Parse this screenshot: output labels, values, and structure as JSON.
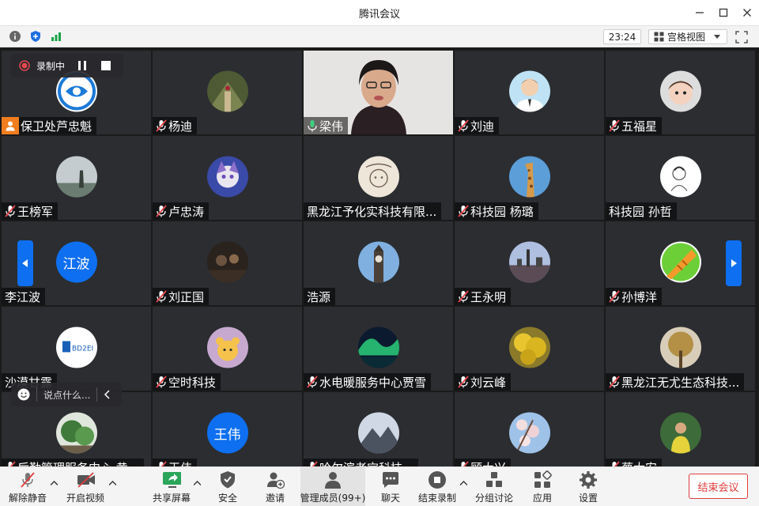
{
  "window": {
    "title": "腾讯会议"
  },
  "toolbar": {
    "timer": "23:24",
    "view_label": "宫格视图"
  },
  "recording": {
    "label": "录制中"
  },
  "chat": {
    "placeholder": "说点什么..."
  },
  "participants": [
    {
      "name": "保卫处芦忠魁",
      "avatar": "logo-badge-blue",
      "muted": false,
      "host": true
    },
    {
      "name": "杨迪",
      "avatar": "forest-photo",
      "muted": true
    },
    {
      "name": "梁伟",
      "avatar": "video-feed",
      "muted": false,
      "speaking": true
    },
    {
      "name": "刘迪",
      "avatar": "cartoon-man",
      "muted": true
    },
    {
      "name": "五福星",
      "avatar": "child-photo",
      "muted": true
    },
    {
      "name": "王榜军",
      "avatar": "misty-photo",
      "muted": true
    },
    {
      "name": "卢忠涛",
      "avatar": "anime-character",
      "muted": true
    },
    {
      "name": "黑龙江予化实科技有限...",
      "avatar": "sketch-badge",
      "muted": false
    },
    {
      "name": "科技园 杨璐",
      "avatar": "giraffe-photo",
      "muted": true
    },
    {
      "name": "科技园 孙哲",
      "avatar": "line-drawing",
      "muted": false
    },
    {
      "name": "李江波",
      "avatar_text": "江波",
      "muted": false
    },
    {
      "name": "刘正国",
      "avatar": "dark-photo",
      "muted": true
    },
    {
      "name": "浩源",
      "avatar": "clocktower-photo",
      "muted": false
    },
    {
      "name": "王永明",
      "avatar": "city-photo",
      "muted": true
    },
    {
      "name": "孙博洋",
      "avatar": "fruit-icon",
      "muted": true
    },
    {
      "name": "沙漠甘露",
      "avatar": "bd-logo",
      "muted": false
    },
    {
      "name": "空时科技",
      "avatar": "cartoon-bear",
      "muted": true
    },
    {
      "name": "水电暖服务中心贾雪",
      "avatar": "aurora-photo",
      "muted": true
    },
    {
      "name": "刘云峰",
      "avatar": "yellow-tree-photo",
      "muted": true
    },
    {
      "name": "黑龙江无尤生态科技...",
      "avatar": "autumn-tree-photo",
      "muted": true
    },
    {
      "name": "后勤管理服务中心 黄...",
      "avatar": "garden-photo",
      "muted": true
    },
    {
      "name": "王伟",
      "avatar_text": "王伟",
      "muted": true
    },
    {
      "name": "哈尔滨老宝科技...",
      "avatar": "mountain-photo",
      "muted": true
    },
    {
      "name": "顾大兴",
      "avatar": "blossom-photo",
      "muted": true
    },
    {
      "name": "蔡大安",
      "avatar": "outdoor-man-photo",
      "muted": true
    }
  ],
  "bottom_toolbar": {
    "unmute": "解除静音",
    "start_video": "开启视频",
    "share_screen": "共享屏幕",
    "security": "安全",
    "invite": "邀请",
    "manage_members": "管理成员(99+)",
    "chat": "聊天",
    "stop_recording": "结束录制",
    "breakout": "分组讨论",
    "apps": "应用",
    "settings": "设置",
    "end_meeting": "结束会议"
  },
  "colors": {
    "accent": "#0e6ff0",
    "speaking": "#3fd07e",
    "danger": "#e03c3c",
    "host": "#f07d1e"
  }
}
